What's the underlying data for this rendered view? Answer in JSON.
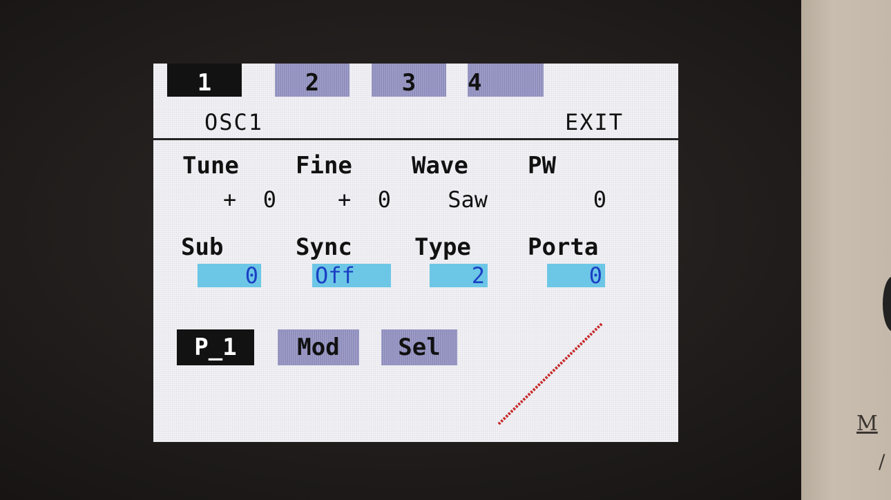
{
  "tabs": [
    {
      "label": "1",
      "active": true
    },
    {
      "label": "2",
      "active": false
    },
    {
      "label": "3",
      "active": false
    },
    {
      "label": "4",
      "active": false
    }
  ],
  "header": {
    "title": "OSC1",
    "exit_label": "EXIT"
  },
  "params_row1": [
    {
      "label": "Tune",
      "value": "+  0"
    },
    {
      "label": "Fine",
      "value": "+  0"
    },
    {
      "label": "Wave",
      "value": "Saw"
    },
    {
      "label": "PW",
      "value": "0"
    }
  ],
  "params_row2": [
    {
      "label": "Sub",
      "value": "0"
    },
    {
      "label": "Sync",
      "value": "Off"
    },
    {
      "label": "Type",
      "value": "2"
    },
    {
      "label": "Porta",
      "value": "0"
    }
  ],
  "buttons": [
    {
      "label": "P_1",
      "active": true
    },
    {
      "label": "Mod",
      "active": false
    },
    {
      "label": "Sel",
      "active": false
    }
  ],
  "colors": {
    "screen_bg": "#f2f2f7",
    "tab_inactive": "#8f8ebd",
    "value_highlight": "#6cc6e6",
    "value_text": "#1a3fc4",
    "curve": "#c62828"
  },
  "icons": {
    "curve": "linear-ramp-graph"
  }
}
